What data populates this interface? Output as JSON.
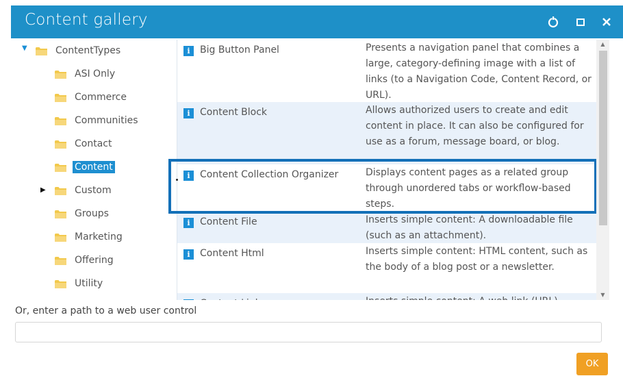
{
  "window": {
    "title": "Content gallery",
    "controls": [
      {
        "name": "refresh-icon"
      },
      {
        "name": "maximize-icon"
      },
      {
        "name": "close-icon"
      }
    ]
  },
  "tree": {
    "root": {
      "label": "ContentTypes",
      "expanded": true
    },
    "items": [
      {
        "label": "ASI Only",
        "selected": false,
        "has_children": false
      },
      {
        "label": "Commerce",
        "selected": false,
        "has_children": false
      },
      {
        "label": "Communities",
        "selected": false,
        "has_children": false
      },
      {
        "label": "Contact",
        "selected": false,
        "has_children": false
      },
      {
        "label": "Content",
        "selected": true,
        "has_children": false
      },
      {
        "label": "Custom",
        "selected": false,
        "has_children": true
      },
      {
        "label": "Groups",
        "selected": false,
        "has_children": false
      },
      {
        "label": "Marketing",
        "selected": false,
        "has_children": false
      },
      {
        "label": "Offering",
        "selected": false,
        "has_children": false
      },
      {
        "label": "Utility",
        "selected": false,
        "has_children": false
      }
    ]
  },
  "list": {
    "rows": [
      {
        "name": "Big Button Panel",
        "desc": "Presents a navigation panel that combines a large, category-defining image with a list of links (to a Navigation Code, Content Record, or URL)."
      },
      {
        "name": "Content Block",
        "desc": "Allows authorized users to create and edit content in place. It can also be configured for use as a forum, message board, or blog."
      },
      {
        "name": "Content Collection Organizer",
        "desc": "Displays content pages as a related group through unordered tabs or workflow-based steps."
      },
      {
        "name": "Content File",
        "desc": "Inserts simple content: A downloadable file (such as an attachment)."
      },
      {
        "name": "Content Html",
        "desc": "Inserts simple content: HTML content, such as the body of a blog post or a newsletter."
      },
      {
        "name": "Content Link",
        "desc": "Inserts simple content: A web link (URL)."
      }
    ]
  },
  "path": {
    "label": "Or, enter a path to a web user control",
    "value": ""
  },
  "buttons": {
    "ok_label": "OK"
  },
  "colors": {
    "titlebar": "#1e90c8",
    "selected": "#1e8fd0",
    "highlight_border": "#1370b8",
    "ok_button": "#f0a024",
    "folder": "#f2c94c"
  }
}
